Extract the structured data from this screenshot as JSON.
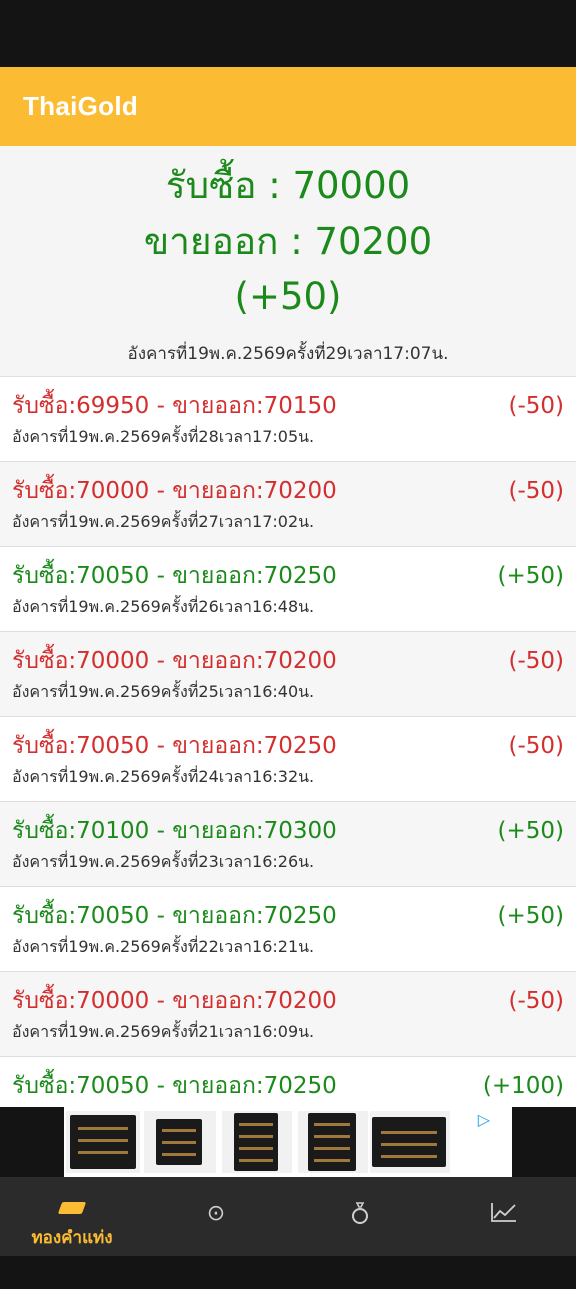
{
  "app": {
    "title": "ThaiGold"
  },
  "summary": {
    "buy": "รับซื้อ : 70000",
    "sell": "ขายออก : 70200",
    "change": "(+50)",
    "timestamp": "อังคารที่19พ.ค.2569ครั้งที่29เวลา17:07น."
  },
  "history": [
    {
      "main": "รับซื้อ:69950 - ขายออก:70150",
      "change": "(-50)",
      "timestamp": "อังคารที่19พ.ค.2569ครั้งที่28เวลา17:05น.",
      "trend": "down"
    },
    {
      "main": "รับซื้อ:70000 - ขายออก:70200",
      "change": "(-50)",
      "timestamp": "อังคารที่19พ.ค.2569ครั้งที่27เวลา17:02น.",
      "trend": "down"
    },
    {
      "main": "รับซื้อ:70050 - ขายออก:70250",
      "change": "(+50)",
      "timestamp": "อังคารที่19พ.ค.2569ครั้งที่26เวลา16:48น.",
      "trend": "up"
    },
    {
      "main": "รับซื้อ:70000 - ขายออก:70200",
      "change": "(-50)",
      "timestamp": "อังคารที่19พ.ค.2569ครั้งที่25เวลา16:40น.",
      "trend": "down"
    },
    {
      "main": "รับซื้อ:70050 - ขายออก:70250",
      "change": "(-50)",
      "timestamp": "อังคารที่19พ.ค.2569ครั้งที่24เวลา16:32น.",
      "trend": "down"
    },
    {
      "main": "รับซื้อ:70100 - ขายออก:70300",
      "change": "(+50)",
      "timestamp": "อังคารที่19พ.ค.2569ครั้งที่23เวลา16:26น.",
      "trend": "up"
    },
    {
      "main": "รับซื้อ:70050 - ขายออก:70250",
      "change": "(+50)",
      "timestamp": "อังคารที่19พ.ค.2569ครั้งที่22เวลา16:21น.",
      "trend": "up"
    },
    {
      "main": "รับซื้อ:70000 - ขายออก:70200",
      "change": "(-50)",
      "timestamp": "อังคารที่19พ.ค.2569ครั้งที่21เวลา16:09น.",
      "trend": "down"
    },
    {
      "main": "รับซื้อ:70050 - ขายออก:70250",
      "change": "(+100)",
      "timestamp": "",
      "trend": "up"
    }
  ],
  "colors": {
    "accent": "#fbbc33",
    "up": "#1b8a1b",
    "down": "#d32f2f"
  },
  "ad": {
    "icon": "ad-choices-play-icon"
  },
  "bottom_nav": {
    "items": [
      {
        "label": "ทองคำแท่ง",
        "icon": "gold-bar-icon",
        "active": true
      },
      {
        "label": "",
        "icon": "target-icon"
      },
      {
        "label": "",
        "icon": "ring-icon"
      },
      {
        "label": "",
        "icon": "chart-trend-icon"
      }
    ]
  }
}
